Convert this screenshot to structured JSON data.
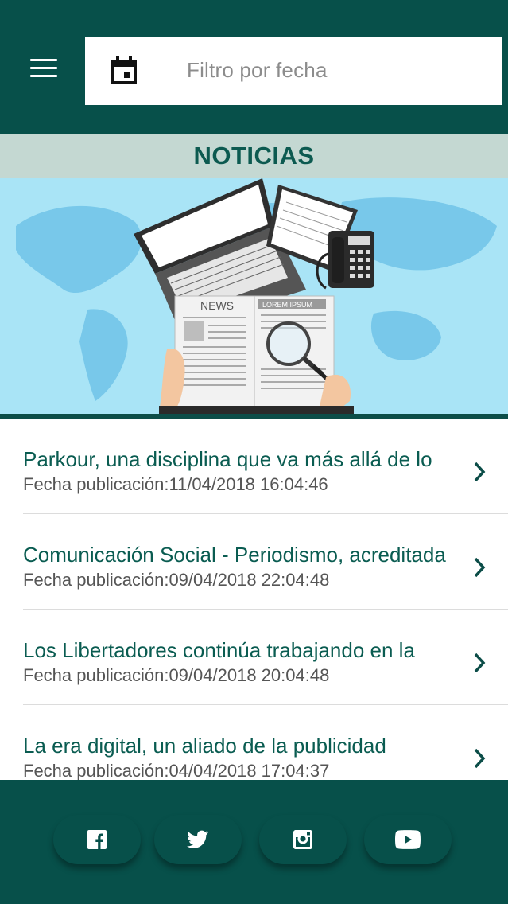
{
  "header": {
    "filter_placeholder": "Filtro por fecha"
  },
  "section": {
    "title": "NOTICIAS"
  },
  "banner": {
    "news_label": "NEWS",
    "lorem_label": "LOREM IPSUM"
  },
  "news": [
    {
      "title": "Parkour, una disciplina que va más allá de lo",
      "date": "Fecha publicación:11/04/2018 16:04:46"
    },
    {
      "title": "Comunicación Social - Periodismo, acreditada",
      "date": "Fecha publicación:09/04/2018 22:04:48"
    },
    {
      "title": "Los Libertadores continúa trabajando en la",
      "date": "Fecha publicación:09/04/2018 20:04:48"
    },
    {
      "title": "La era digital, un aliado de la publicidad",
      "date": "Fecha publicación:04/04/2018 17:04:37"
    }
  ],
  "social": [
    {
      "icon": "facebook-icon"
    },
    {
      "icon": "twitter-icon"
    },
    {
      "icon": "instagram-icon"
    },
    {
      "icon": "youtube-icon"
    }
  ],
  "colors": {
    "primary": "#07504a",
    "section_bg": "#c4d8d2",
    "accent_text": "#0c5a50"
  }
}
